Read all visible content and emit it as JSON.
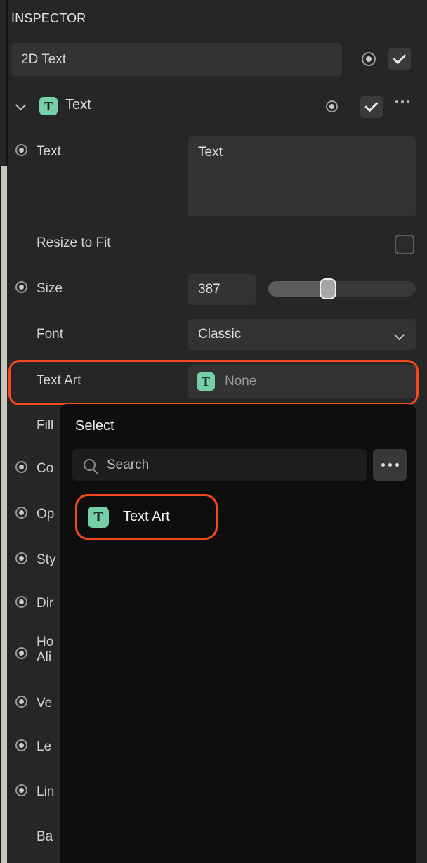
{
  "inspector": {
    "title": "INSPECTOR",
    "name_field": {
      "value": "2D Text"
    },
    "record_icon": "record-icon",
    "check_icon": "check-icon",
    "component": {
      "name": "Text",
      "icon": "text-art-icon",
      "caret": "chevron-down-icon",
      "more": "ellipsis-icon"
    },
    "properties": [
      {
        "label": "Text",
        "value": "Text",
        "has_record": true
      },
      {
        "label": "Resize to Fit",
        "checked": false,
        "has_record": false
      },
      {
        "label": "Size",
        "value": "387",
        "has_record": true
      },
      {
        "label": "Font",
        "value": "Classic",
        "has_record": false
      },
      {
        "label": "Text Art",
        "value": "None",
        "has_record": false
      }
    ],
    "obscured_properties": [
      {
        "label": "Fill",
        "has_record": false
      },
      {
        "label": "Co",
        "has_record": true
      },
      {
        "label": "Op",
        "has_record": true
      },
      {
        "label": "Sty",
        "has_record": true
      },
      {
        "label": "Dir",
        "has_record": true
      },
      {
        "label": "Ho\nAli",
        "has_record": true
      },
      {
        "label": "Ve",
        "has_record": true
      },
      {
        "label": "Le",
        "has_record": true
      },
      {
        "label": "Lin",
        "has_record": true
      },
      {
        "label": "Ba",
        "has_record": false
      }
    ]
  },
  "popup": {
    "title": "Select",
    "search": {
      "placeholder": "Search",
      "icon": "search-icon"
    },
    "more_button": "ellipsis-icon",
    "options": [
      {
        "label": "Text Art",
        "icon": "text-art-icon",
        "highlighted": true
      }
    ]
  },
  "colors": {
    "highlight": "#f4481e",
    "icon_green": "#76cfa6",
    "panel_bg": "#262626",
    "popup_bg": "#0e0e0e",
    "field_bg": "#333333"
  },
  "icon_glyphs": {
    "text_art": "T"
  }
}
